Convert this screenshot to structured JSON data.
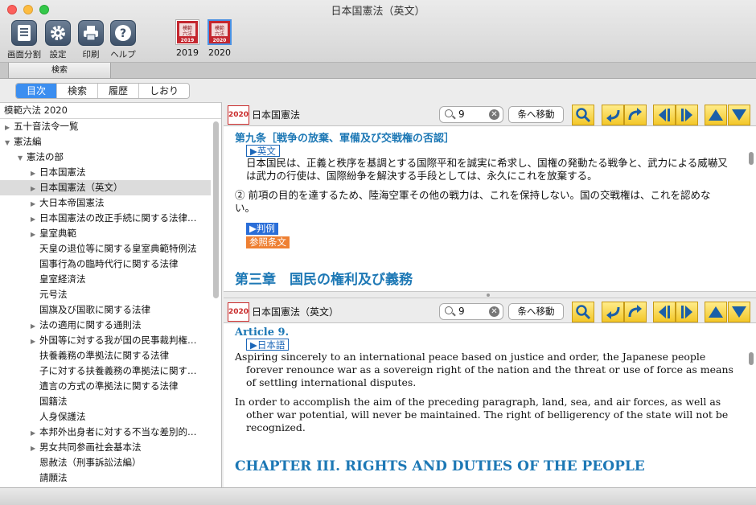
{
  "window": {
    "title": "日本国憲法（英文）"
  },
  "toolbar": {
    "buttons": [
      {
        "label": "画面分割",
        "icon": "split-screen-icon"
      },
      {
        "label": "設定",
        "icon": "gear-icon"
      },
      {
        "label": "印刷",
        "icon": "printer-icon"
      },
      {
        "label": "ヘルプ",
        "icon": "help-icon"
      }
    ],
    "books": [
      {
        "label": "2019",
        "cover_text": "模範六法",
        "cover_year": "2019"
      },
      {
        "label": "2020",
        "cover_text": "模範六法",
        "cover_year": "2020",
        "selected": true
      }
    ]
  },
  "search_tab": {
    "label": "検索"
  },
  "segments": [
    {
      "label": "目次",
      "active": true
    },
    {
      "label": "検索"
    },
    {
      "label": "履歴"
    },
    {
      "label": "しおり"
    }
  ],
  "sidebar": {
    "header": "模範六法 2020",
    "items": [
      {
        "label": "五十音法令一覧",
        "indent": 0,
        "arrow": "closed"
      },
      {
        "label": "憲法編",
        "indent": 0,
        "arrow": "open"
      },
      {
        "label": "憲法の部",
        "indent": 1,
        "arrow": "open"
      },
      {
        "label": "日本国憲法",
        "indent": 2,
        "arrow": "closed"
      },
      {
        "label": "日本国憲法（英文）",
        "indent": 2,
        "arrow": "closed",
        "selected": true
      },
      {
        "label": "大日本帝国憲法",
        "indent": 2,
        "arrow": "closed"
      },
      {
        "label": "日本国憲法の改正手続に関する法律…",
        "indent": 2,
        "arrow": "closed"
      },
      {
        "label": "皇室典範",
        "indent": 2,
        "arrow": "closed"
      },
      {
        "label": "天皇の退位等に関する皇室典範特例法",
        "indent": 2,
        "arrow": "none"
      },
      {
        "label": "国事行為の臨時代行に関する法律",
        "indent": 2,
        "arrow": "none"
      },
      {
        "label": "皇室経済法",
        "indent": 2,
        "arrow": "none"
      },
      {
        "label": "元号法",
        "indent": 2,
        "arrow": "none"
      },
      {
        "label": "国旗及び国歌に関する法律",
        "indent": 2,
        "arrow": "none"
      },
      {
        "label": "法の適用に関する通則法",
        "indent": 2,
        "arrow": "closed"
      },
      {
        "label": "外国等に対する我が国の民事裁判権…",
        "indent": 2,
        "arrow": "closed"
      },
      {
        "label": "扶養義務の準拠法に関する法律",
        "indent": 2,
        "arrow": "none"
      },
      {
        "label": "子に対する扶養義務の準拠法に関す…",
        "indent": 2,
        "arrow": "none"
      },
      {
        "label": "遺言の方式の準拠法に関する法律",
        "indent": 2,
        "arrow": "none"
      },
      {
        "label": "国籍法",
        "indent": 2,
        "arrow": "none"
      },
      {
        "label": "人身保護法",
        "indent": 2,
        "arrow": "none"
      },
      {
        "label": "本邦外出身者に対する不当な差別的…",
        "indent": 2,
        "arrow": "closed"
      },
      {
        "label": "男女共同参画社会基本法",
        "indent": 2,
        "arrow": "closed"
      },
      {
        "label": "恩赦法（刑事訴訟法編）",
        "indent": 2,
        "arrow": "none"
      },
      {
        "label": "請願法",
        "indent": 2,
        "arrow": "none"
      }
    ]
  },
  "pane_top": {
    "badge": "2020",
    "title": "日本国憲法",
    "search_value": "9",
    "move_label": "条へ移動",
    "article_heading": "第九条［戦争の放棄、軍備及び交戦権の否認］",
    "tag_english": "▶英文",
    "para1": "日本国民は、正義と秩序を基調とする国際平和を誠実に希求し、国権の発動たる戦争と、武力による威嚇又は武力の行使は、国際紛争を解決する手段としては、永久にこれを放棄する。",
    "para2": "② 前項の目的を達するため、陸海空軍その他の戦力は、これを保持しない。国の交戦権は、これを認めない。",
    "tag_cases": "▶判例",
    "tag_refs": "参照条文",
    "chapter": "第三章　国民の権利及び義務"
  },
  "pane_bottom": {
    "badge": "2020",
    "title": "日本国憲法（英文）",
    "search_value": "9",
    "move_label": "条へ移動",
    "article_heading": "Article 9.",
    "tag_japanese": "▶日本語",
    "para1": "Aspiring sincerely to an international peace based on justice and order, the Japanese people forever renounce war as a sovereign right of the nation and the threat or use of force as means of settling international disputes.",
    "para2": "In order to accomplish the aim of the preceding paragraph, land, sea, and air forces, as well as other war potential, will never be maintained. The right of belligerency of the state will not be recognized.",
    "chapter": "CHAPTER III. RIGHTS AND DUTIES OF THE PEOPLE"
  },
  "colors": {
    "accent": "#3b8ef0",
    "heading": "#1d78b5",
    "badge": "#c92b2b",
    "nav_button": "#f3c729",
    "tag_blue": "#2a6ed8",
    "tag_orange": "#ee8033"
  }
}
